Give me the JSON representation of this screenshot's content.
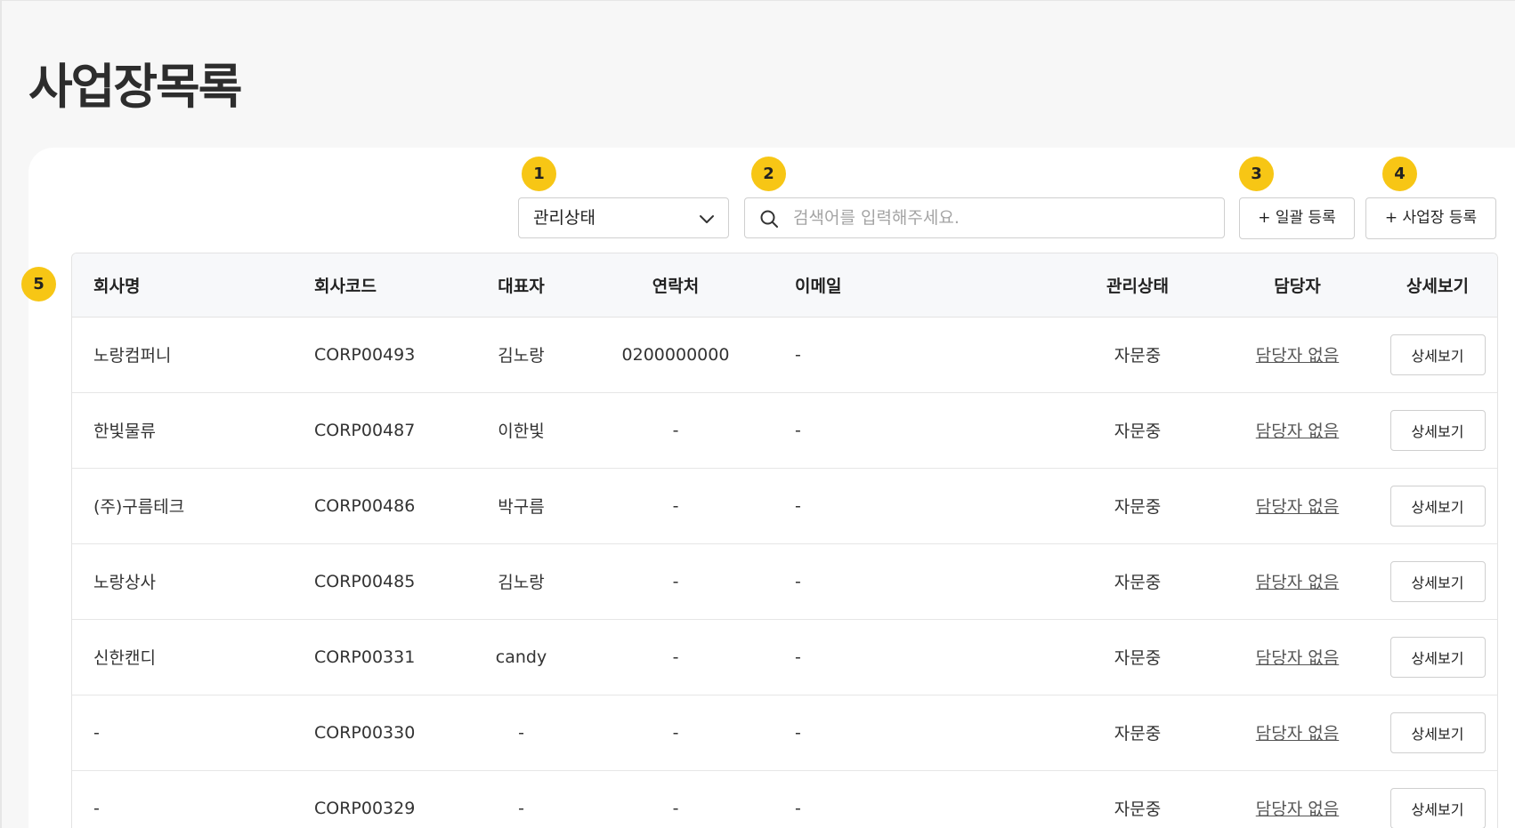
{
  "page": {
    "title": "사업장목록"
  },
  "annotations": [
    "1",
    "2",
    "3",
    "4",
    "5"
  ],
  "filter": {
    "status_select_value": "관리상태",
    "search_placeholder": "검색어를 입력해주세요."
  },
  "toolbar": {
    "bulk_register_label": "+ 일괄 등록",
    "add_site_label": "+ 사업장 등록"
  },
  "table": {
    "columns": [
      "회사명",
      "회사코드",
      "대표자",
      "연락처",
      "이메일",
      "관리상태",
      "담당자",
      "상세보기"
    ],
    "rows": [
      {
        "company": "노랑컴퍼니",
        "code": "CORP00493",
        "ceo": "김노랑",
        "phone": "0200000000",
        "email": "-",
        "status": "자문중",
        "manager": "담당자 없음",
        "detail": "상세보기"
      },
      {
        "company": "한빛물류",
        "code": "CORP00487",
        "ceo": "이한빛",
        "phone": "-",
        "email": "-",
        "status": "자문중",
        "manager": "담당자 없음",
        "detail": "상세보기"
      },
      {
        "company": "(주)구름테크",
        "code": "CORP00486",
        "ceo": "박구름",
        "phone": "-",
        "email": "-",
        "status": "자문중",
        "manager": "담당자 없음",
        "detail": "상세보기"
      },
      {
        "company": "노랑상사",
        "code": "CORP00485",
        "ceo": "김노랑",
        "phone": "-",
        "email": "-",
        "status": "자문중",
        "manager": "담당자 없음",
        "detail": "상세보기"
      },
      {
        "company": "신한캔디",
        "code": "CORP00331",
        "ceo": "candy",
        "phone": "-",
        "email": "-",
        "status": "자문중",
        "manager": "담당자 없음",
        "detail": "상세보기"
      },
      {
        "company": "-",
        "code": "CORP00330",
        "ceo": "-",
        "phone": "-",
        "email": "-",
        "status": "자문중",
        "manager": "담당자 없음",
        "detail": "상세보기"
      },
      {
        "company": "-",
        "code": "CORP00329",
        "ceo": "-",
        "phone": "-",
        "email": "-",
        "status": "자문중",
        "manager": "담당자 없음",
        "detail": "상세보기"
      }
    ]
  },
  "colors": {
    "badge": "#f7c615",
    "header_bg": "#f7f8fa",
    "page_bg": "#f7f7f7"
  },
  "icons": {
    "select": "chevron-down-icon",
    "search": "search-icon"
  }
}
